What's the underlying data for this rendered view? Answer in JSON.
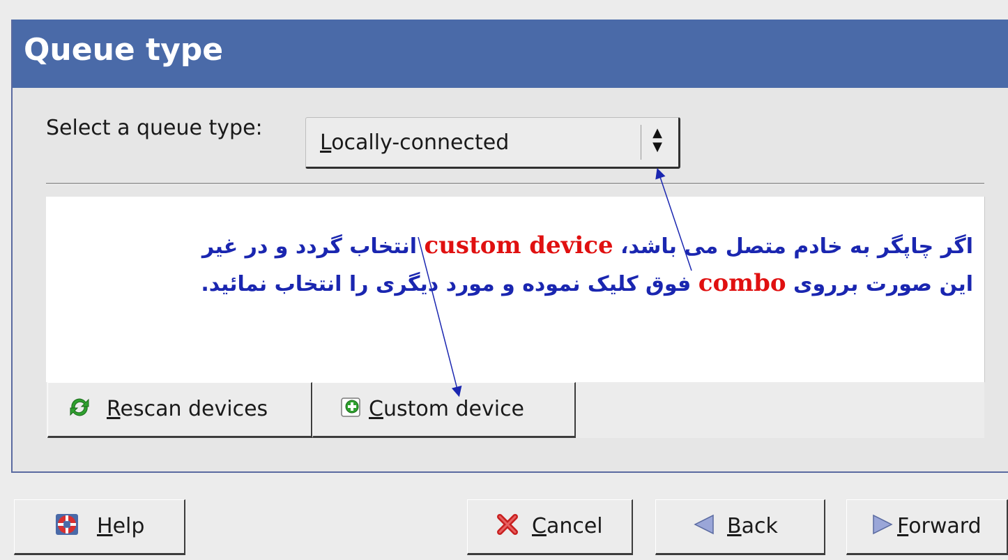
{
  "window": {
    "title": "Queue type"
  },
  "queue": {
    "label": "Select a queue type:",
    "selected": "Locally-connected"
  },
  "annotation": {
    "line1_part1": "اگر چاپگر به خادم متصل می باشد، ",
    "line1_highlight": "custom device",
    "line1_part2": " انتخاب گردد و در غیر",
    "line2_part1": "این صورت برروی ",
    "line2_highlight": "combo",
    "line2_part2": " فوق کلیک نموده و مورد دیگری را انتخاب نمائید."
  },
  "device_buttons": {
    "rescan": "Rescan devices",
    "custom": "Custom device"
  },
  "footer": {
    "help": "Help",
    "cancel": "Cancel",
    "back": "Back",
    "forward": "Forward"
  },
  "colors": {
    "title_bar": "#4a6aa8",
    "annotation_text": "#1a26b0",
    "annotation_highlight": "#e01010"
  },
  "icons": {
    "rescan": "refresh-icon",
    "custom": "add-device-icon",
    "help": "lifebuoy-icon",
    "cancel": "cancel-x-icon",
    "back": "back-arrow-icon",
    "forward": "forward-arrow-icon",
    "combo": "updown-arrows-icon"
  }
}
